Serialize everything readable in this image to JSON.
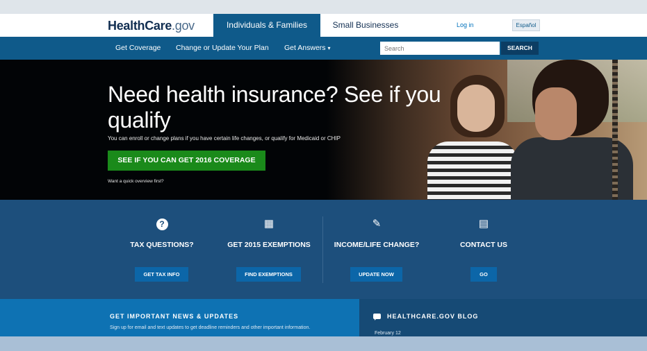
{
  "header": {
    "logo_main": "HealthCare",
    "logo_suffix": ".gov",
    "tab_individuals": "Individuals & Families",
    "tab_small_business": "Small Businesses",
    "login": "Log in",
    "language": "Español"
  },
  "nav": {
    "get_coverage": "Get Coverage",
    "change_plan": "Change or Update Your Plan",
    "get_answers": "Get Answers",
    "dropdown_glyph": "▾",
    "search_placeholder": "Search",
    "search_button": "SEARCH"
  },
  "hero": {
    "title": "Need health insurance? See if you qualify",
    "subtitle": "You can enroll or change plans if you have certain life changes, or qualify for Medicaid or CHIP",
    "cta": "SEE IF YOU CAN GET 2016 COVERAGE",
    "quote_link": "Want a quick overview first?"
  },
  "quick_links": [
    {
      "icon": "question-icon",
      "glyph": "?",
      "title": "TAX QUESTIONS?",
      "button": "GET TAX INFO"
    },
    {
      "icon": "calendar-icon",
      "glyph": "▦",
      "title": "GET 2015 EXEMPTIONS",
      "button": "FIND EXEMPTIONS"
    },
    {
      "icon": "edit-icon",
      "glyph": "✎",
      "title": "INCOME/LIFE CHANGE?",
      "button": "UPDATE NOW"
    },
    {
      "icon": "contact-icon",
      "glyph": "▤",
      "title": "CONTACT US",
      "button": "GO"
    }
  ],
  "news": {
    "title": "GET IMPORTANT NEWS & UPDATES",
    "text": "Sign up for email and text updates to get deadline reminders and other important information."
  },
  "blog": {
    "title": "HEALTHCARE.GOV BLOG",
    "date": "February 12"
  },
  "colors": {
    "primary_blue": "#0f5a8a",
    "cta_green": "#1a8a1a",
    "quick_bg": "#1d4f7c"
  }
}
